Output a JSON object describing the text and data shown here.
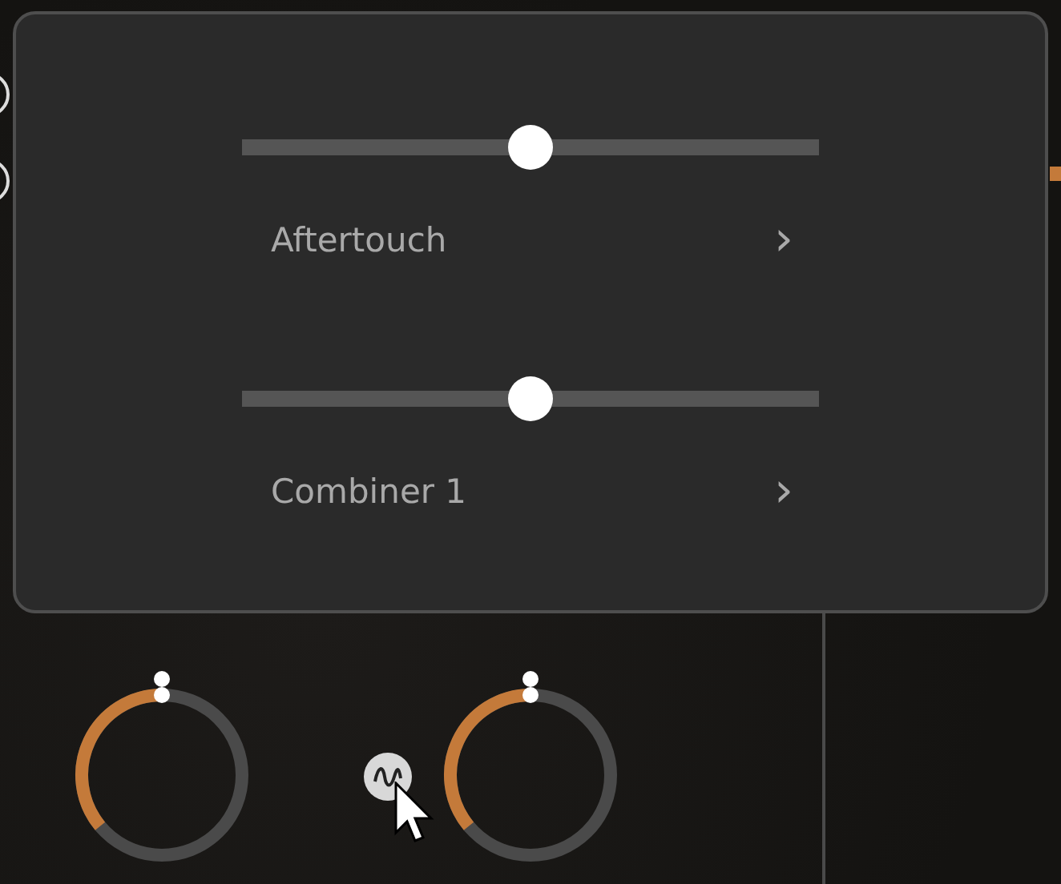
{
  "popup": {
    "rows": [
      {
        "level": 0.5,
        "label": "Aftertouch",
        "chevron": "›"
      },
      {
        "level": 0.5,
        "label": "Combiner 1",
        "chevron": "›"
      }
    ]
  }
}
